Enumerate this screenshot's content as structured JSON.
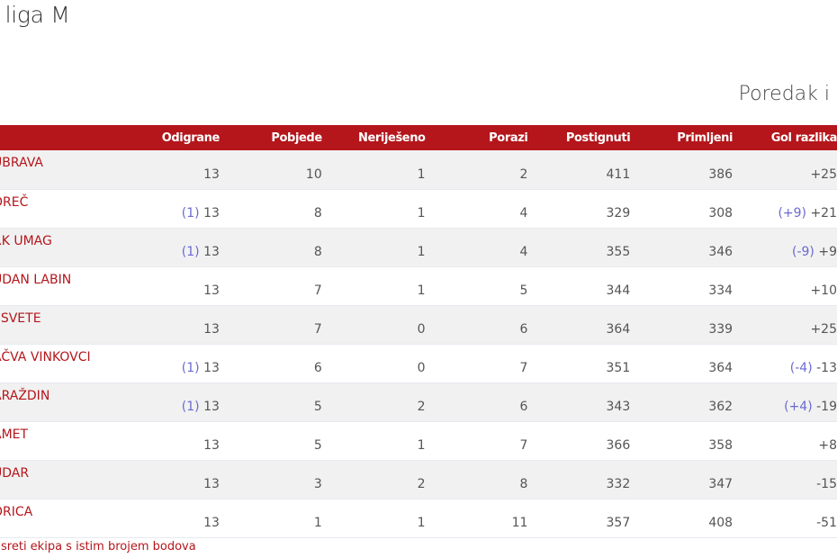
{
  "page_title": "r liga M",
  "section_title": "Poredak i",
  "table": {
    "headers": {
      "played": "Odigrane",
      "wins": "Pobjede",
      "draws": "Neriješeno",
      "losses": "Porazi",
      "scored": "Postignuti",
      "conceded": "Primljeni",
      "goal_diff": "Gol razlika"
    },
    "rows": [
      {
        "team": "UBRAVA",
        "played_note": "",
        "played": "13",
        "wins": "10",
        "draws": "1",
        "losses": "2",
        "scored": "411",
        "conceded": "386",
        "gd_note": "",
        "gd": "+25"
      },
      {
        "team": "OREČ",
        "played_note": "(1)",
        "played": "13",
        "wins": "8",
        "draws": "1",
        "losses": "4",
        "scored": "329",
        "conceded": "308",
        "gd_note": "(+9)",
        "gd": "+21"
      },
      {
        "team": "RK UMAG",
        "played_note": "(1)",
        "played": "13",
        "wins": "8",
        "draws": "1",
        "losses": "4",
        "scored": "355",
        "conceded": "346",
        "gd_note": "(-9)",
        "gd": "+9"
      },
      {
        "team": "UDAN LABIN",
        "played_note": "",
        "played": "13",
        "wins": "7",
        "draws": "1",
        "losses": "5",
        "scored": "344",
        "conceded": "334",
        "gd_note": "",
        "gd": "+10"
      },
      {
        "team": "ESVETE",
        "played_note": "",
        "played": "13",
        "wins": "7",
        "draws": "0",
        "losses": "6",
        "scored": "364",
        "conceded": "339",
        "gd_note": "",
        "gd": "+25"
      },
      {
        "team": "AČVA VINKOVCI",
        "played_note": "(1)",
        "played": "13",
        "wins": "6",
        "draws": "0",
        "losses": "7",
        "scored": "351",
        "conceded": "364",
        "gd_note": "(-4)",
        "gd": "-13"
      },
      {
        "team": "ARAŽDIN",
        "played_note": "(1)",
        "played": "13",
        "wins": "5",
        "draws": "2",
        "losses": "6",
        "scored": "343",
        "conceded": "362",
        "gd_note": "(+4)",
        "gd": "-19"
      },
      {
        "team": "AMET",
        "played_note": "",
        "played": "13",
        "wins": "5",
        "draws": "1",
        "losses": "7",
        "scored": "366",
        "conceded": "358",
        "gd_note": "",
        "gd": "+8"
      },
      {
        "team": "UDAR",
        "played_note": "",
        "played": "13",
        "wins": "3",
        "draws": "2",
        "losses": "8",
        "scored": "332",
        "conceded": "347",
        "gd_note": "",
        "gd": "-15"
      },
      {
        "team": "ORICA",
        "played_note": "",
        "played": "13",
        "wins": "1",
        "draws": "1",
        "losses": "11",
        "scored": "357",
        "conceded": "408",
        "gd_note": "",
        "gd": "-51"
      }
    ]
  },
  "footnote": "susreti ekipa s istim brojem bodova",
  "colors": {
    "header_bg": "#b4161b",
    "team_text": "#b4161b",
    "note_text": "#6a6ad0"
  }
}
